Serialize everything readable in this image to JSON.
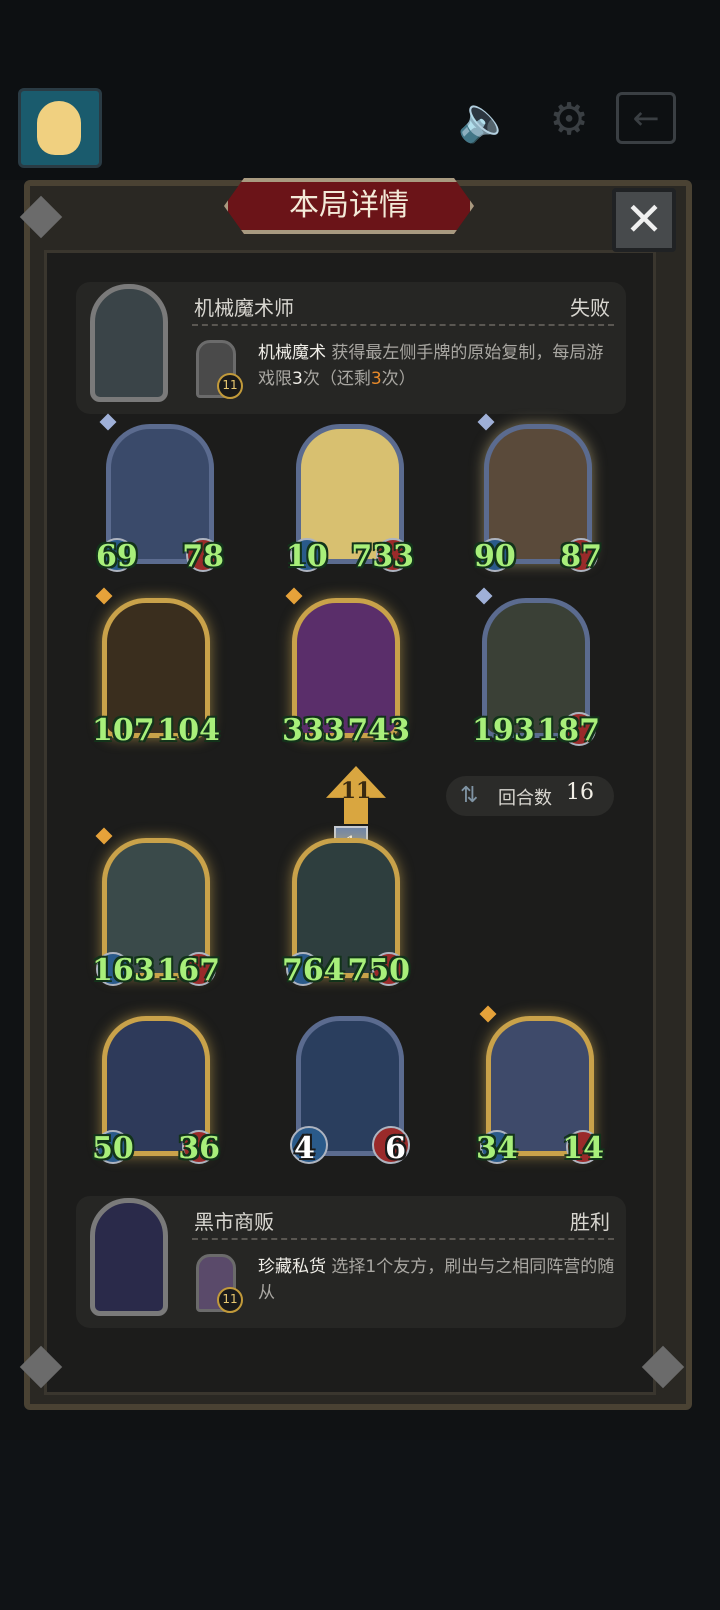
{
  "header": {
    "title": "本局详情",
    "close_icon": "close-icon",
    "icons": [
      "avatar",
      "speaker-icon",
      "settings-gear-icon",
      "exit-door-icon"
    ]
  },
  "opponent_top": {
    "name": "机械魔术师",
    "result": "失败",
    "skill_name": "机械魔术",
    "skill_desc_1": " 获得最左侧手牌的原始复制，每局游戏限",
    "skill_count": "3",
    "skill_desc_2": "次（还剩",
    "skill_remaining": "3",
    "skill_desc_3": "次）",
    "skill_level": "11"
  },
  "cards": [
    {
      "atk": "69",
      "hp": "78"
    },
    {
      "atk": "10",
      "hp": "733"
    },
    {
      "atk": "90",
      "hp": "87"
    },
    {
      "atk": "107",
      "hp": "104"
    },
    {
      "atk": "333",
      "hp": "743"
    },
    {
      "atk": "193",
      "hp": "187"
    },
    {
      "atk": "163",
      "hp": "167"
    },
    {
      "atk": "764",
      "hp": "750"
    },
    {
      "atk": "50",
      "hp": "36"
    },
    {
      "atk": "4",
      "hp": "6"
    },
    {
      "atk": "34",
      "hp": "14"
    }
  ],
  "rounds": {
    "label": "回合数",
    "value": "16",
    "icon": "cycle-icon"
  },
  "tier": {
    "arrow_value": "11",
    "box_value": "1"
  },
  "opponent_bottom": {
    "name": "黑市商贩",
    "result": "胜利",
    "skill_name": "珍藏私货",
    "skill_desc": " 选择1个友方，刷出与之相同阵营的随从",
    "skill_level": "11"
  },
  "colors": {
    "stat_green": "#a8ef7a",
    "gold_frame": "#c9a24a",
    "silver_frame": "#5b6b8f",
    "banner": "#6b1418"
  }
}
